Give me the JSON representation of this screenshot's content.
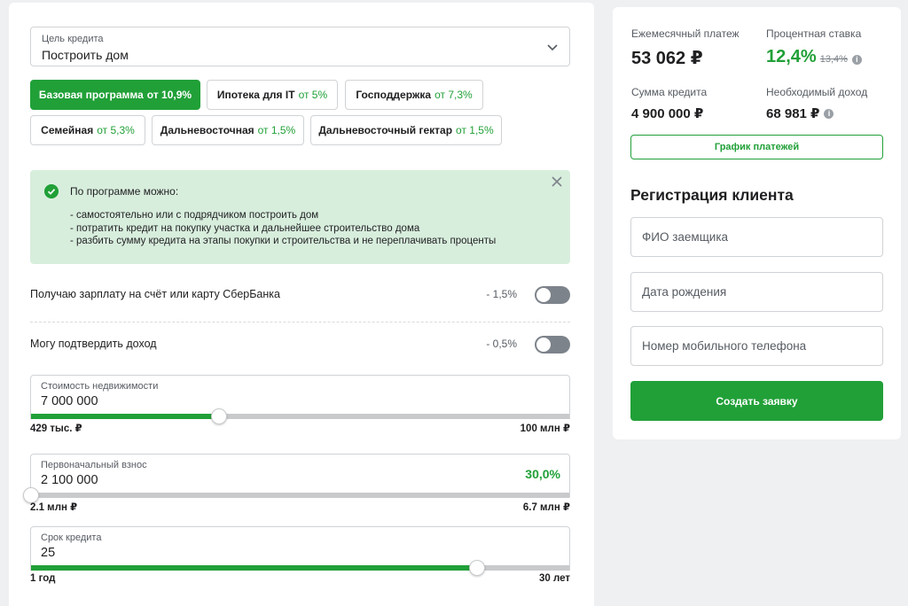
{
  "purpose": {
    "label": "Цель кредита",
    "value": "Построить дом"
  },
  "programs": [
    {
      "name": "Базовая программа",
      "rate": "от 10,9%",
      "active": true
    },
    {
      "name": "Ипотека для IT",
      "rate": "от 5%"
    },
    {
      "name": "Господдержка",
      "rate": "от 7,3%"
    },
    {
      "name": "Семейная",
      "rate": "от 5,3%"
    },
    {
      "name": "Дальневосточная",
      "rate": "от 1,5%"
    },
    {
      "name": "Дальневосточный гектар",
      "rate": "от 1,5%"
    }
  ],
  "info": {
    "title": "По программе можно:",
    "items": [
      "самостоятельно или с подрядчиком построить дом",
      "потратить кредит на покупку участка и дальнейшее строительство дома",
      "разбить сумму кредита на этапы покупки и строительства и не переплачивать проценты"
    ]
  },
  "toggles": [
    {
      "label": "Получаю зарплату на счёт или карту СберБанка",
      "discount": "- 1,5%",
      "on": false
    },
    {
      "label": "Могу подтвердить доход",
      "discount": "- 0,5%",
      "on": false
    }
  ],
  "property": {
    "label": "Стоимость недвижимости",
    "value": "7 000 000",
    "min": "429 тыс. ₽",
    "max": "100 млн ₽",
    "fraction": 0.35
  },
  "down_payment": {
    "label": "Первоначальный взнос",
    "value": "2 100 000",
    "percent": "30,0%",
    "min": "2.1 млн ₽",
    "max": "6.7 млн ₽",
    "fraction": 0.0
  },
  "term": {
    "label": "Срок кредита",
    "value": "25",
    "min": "1 год",
    "max": "30 лет",
    "fraction": 0.828
  },
  "summary": {
    "monthly_label": "Ежемесячный платеж",
    "monthly_value": "53 062 ₽",
    "rate_label": "Процентная ставка",
    "rate_value": "12,4%",
    "rate_old": "13,4%",
    "loan_label": "Сумма кредита",
    "loan_value": "4 900 000 ₽",
    "income_label": "Необходимый доход",
    "income_value": "68 981 ₽",
    "schedule_button": "График платежей"
  },
  "registration": {
    "title": "Регистрация клиента",
    "name_placeholder": "ФИО заемщика",
    "birth_placeholder": "Дата рождения",
    "phone_placeholder": "Номер мобильного телефона",
    "submit": "Создать заявку"
  },
  "colors": {
    "accent": "#21a038",
    "info_bg": "#d8eedd",
    "page_bg": "#eef0f2"
  }
}
